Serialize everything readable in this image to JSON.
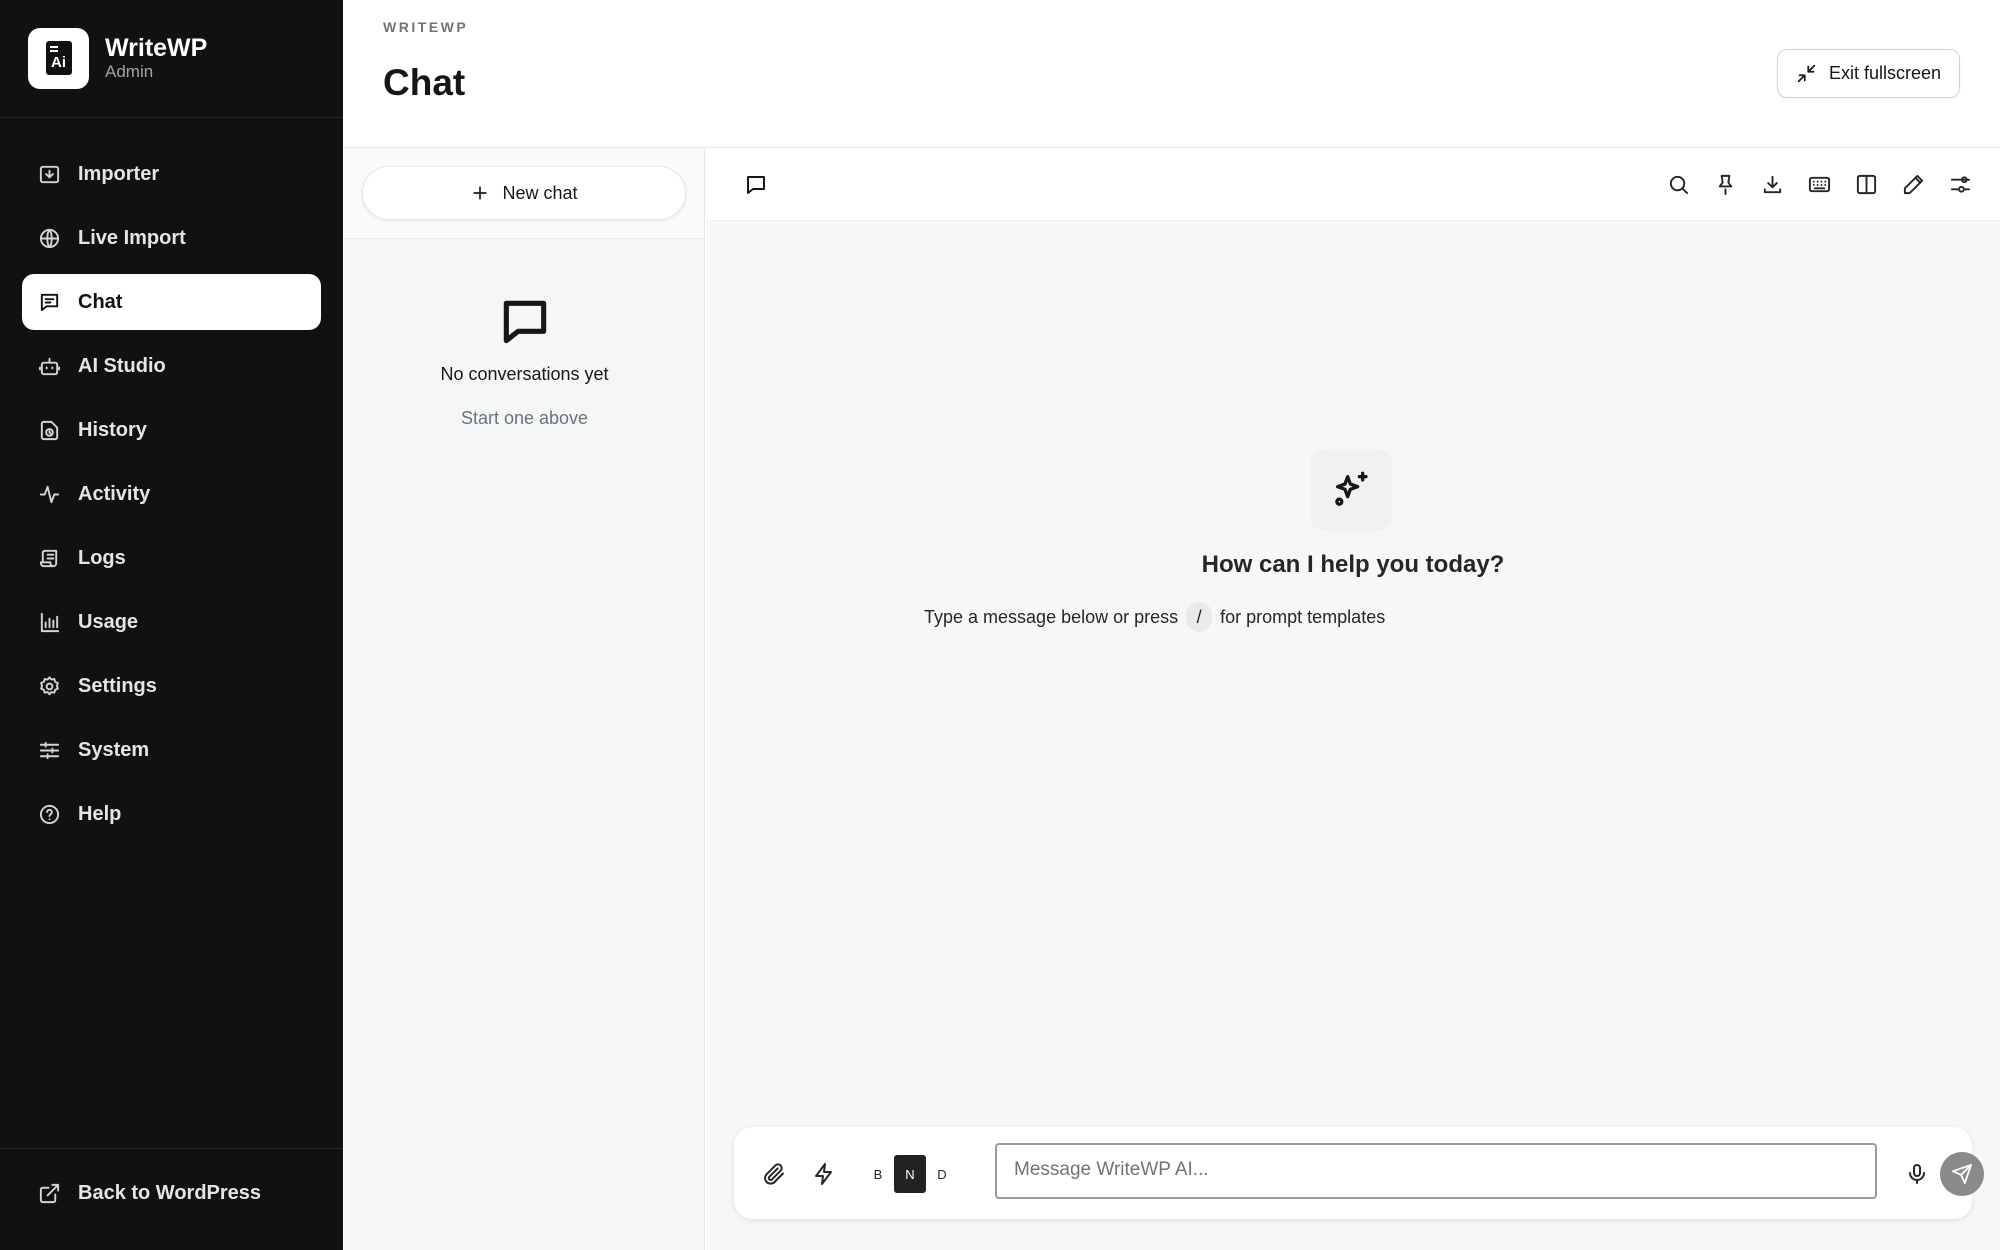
{
  "brand": {
    "name": "WriteWP",
    "subtitle": "Admin",
    "logo_text": "Ai"
  },
  "sidebar": {
    "items": [
      {
        "label": "Importer",
        "icon": "import-icon"
      },
      {
        "label": "Live Import",
        "icon": "globe-icon"
      },
      {
        "label": "Chat",
        "icon": "chat-lines-icon",
        "active": true
      },
      {
        "label": "AI Studio",
        "icon": "robot-icon"
      },
      {
        "label": "History",
        "icon": "history-icon"
      },
      {
        "label": "Activity",
        "icon": "pulse-icon"
      },
      {
        "label": "Logs",
        "icon": "scroll-icon"
      },
      {
        "label": "Usage",
        "icon": "bar-chart-icon"
      },
      {
        "label": "Settings",
        "icon": "gear-icon"
      },
      {
        "label": "System",
        "icon": "sliders-icon"
      },
      {
        "label": "Help",
        "icon": "help-circle-icon"
      }
    ],
    "footer_link": "Back to WordPress"
  },
  "header": {
    "eyebrow": "WRITEWP",
    "title": "Chat",
    "exit_fullscreen": "Exit fullscreen"
  },
  "conversations": {
    "new_chat": "New chat",
    "empty_title": "No conversations yet",
    "empty_sub": "Start one above"
  },
  "chat": {
    "welcome_title": "How can I help you today?",
    "hint_before": "Type a message below or press",
    "hint_key": "/",
    "hint_after": "for prompt templates",
    "toolbar_icons": [
      "search-icon",
      "pin-icon",
      "download-icon",
      "keyboard-icon",
      "split-view-icon",
      "edit-icon",
      "settings-toggle-icon"
    ]
  },
  "composer": {
    "placeholder": "Message WriteWP AI...",
    "modes": [
      "B",
      "N",
      "D"
    ],
    "active_mode": "N"
  },
  "colors": {
    "sidebar_bg": "#111111",
    "active_nav_bg": "#ffffff",
    "send_button": "#8a8a8a"
  }
}
